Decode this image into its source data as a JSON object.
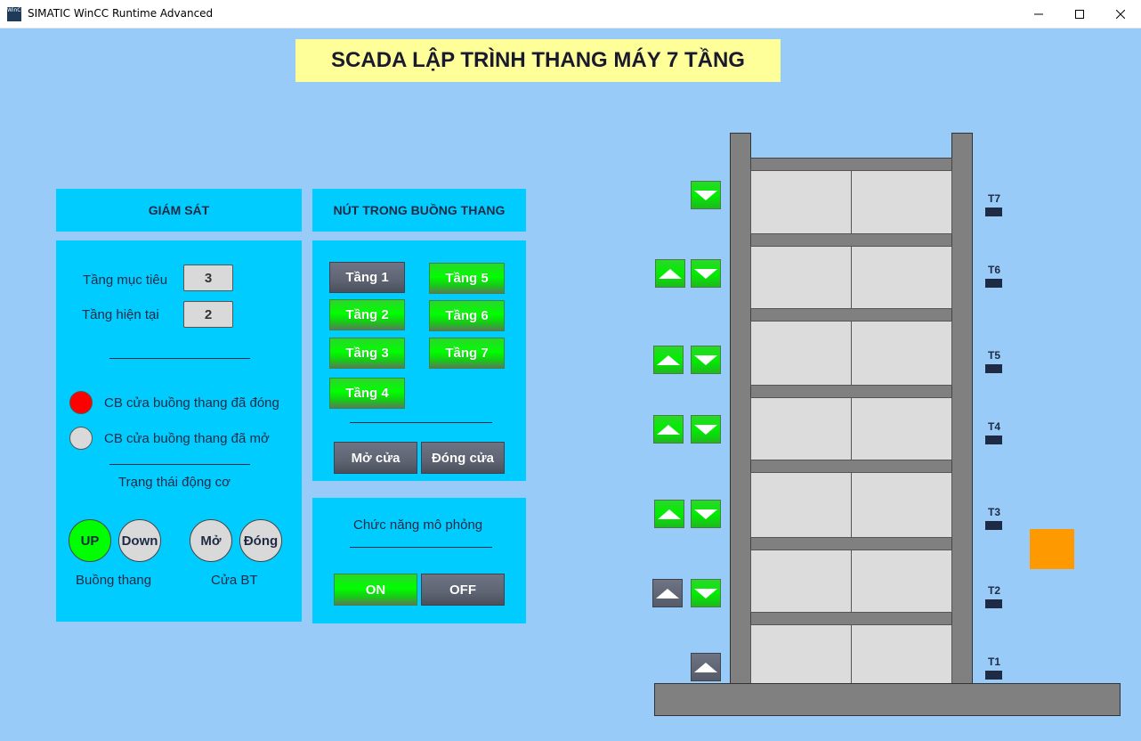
{
  "window": {
    "title": "SIMATIC WinCC Runtime Advanced",
    "icon_text": "WinCC"
  },
  "page_title": "SCADA LẬP TRÌNH THANG MÁY 7 TẦNG",
  "monitor": {
    "header": "GIÁM SÁT",
    "target_floor_label": "Tầng mục tiêu",
    "target_floor_value": "3",
    "current_floor_label": "Tầng hiện tại",
    "current_floor_value": "2",
    "door_closed_label": "CB cửa buồng thang đã đóng",
    "door_open_label": "CB cửa buồng thang đã mở",
    "door_closed_color": "#ff0000",
    "door_open_color": "#d9d9d9",
    "motor_status_label": "Trạng thái động cơ",
    "up_label": "UP",
    "down_label": "Down",
    "open_label": "Mở",
    "close_label": "Đóng",
    "up_color": "#00ff00",
    "idle_color": "#d9d9d9",
    "car_label": "Buồng thang",
    "door_label": "Cửa BT"
  },
  "cabin_buttons": {
    "header": "NÚT TRONG BUỒNG THANG",
    "floors": [
      "Tầng 1",
      "Tầng 2",
      "Tầng 3",
      "Tầng 4",
      "Tầng 5",
      "Tầng 6",
      "Tầng 7"
    ],
    "open_door": "Mở cửa",
    "close_door": "Đóng cửa"
  },
  "simulation": {
    "header": "Chức năng mô phỏng",
    "on": "ON",
    "off": "OFF"
  },
  "building": {
    "floors": [
      "T7",
      "T6",
      "T5",
      "T4",
      "T3",
      "T2",
      "T1"
    ],
    "car_color": "#ff9900"
  },
  "colors": {
    "background": "#99cbf9",
    "panel": "#00ccff",
    "title_bg": "#ffff99",
    "button_green": "#00ff00",
    "button_gray": "#5e6472"
  },
  "icons": [
    "minimize-icon",
    "maximize-icon",
    "close-icon",
    "up-arrow-icon",
    "down-arrow-icon"
  ]
}
